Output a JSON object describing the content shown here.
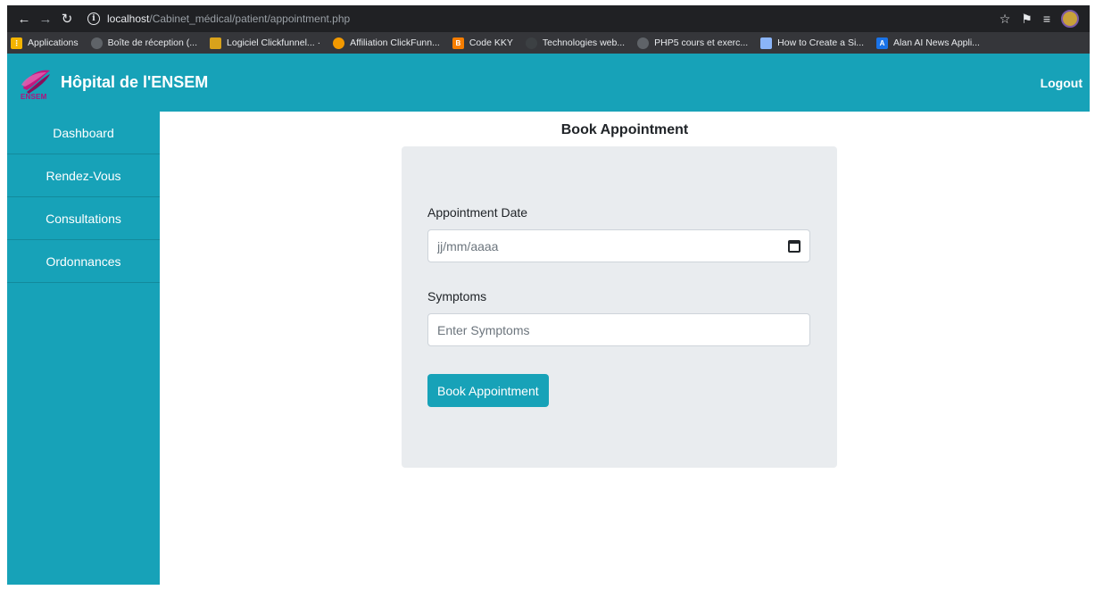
{
  "browser": {
    "url_host": "localhost",
    "url_path": "/Cabinet_médical/patient/appointment.php",
    "bookmarks": [
      {
        "label": "Applications",
        "icon": "apps-grid-icon",
        "color": "#f4b400"
      },
      {
        "label": "Boîte de réception (...",
        "icon": "globe-icon",
        "color": "#5f6368"
      },
      {
        "label": "Logiciel Clickfunnel... ·",
        "icon": "clickfunnels-icon",
        "color": "#d9a21b"
      },
      {
        "label": "Affiliation ClickFunn...",
        "icon": "shield-icon",
        "color": "#f29900"
      },
      {
        "label": "Code KKY",
        "icon": "blogger-icon",
        "color": "#f57d00"
      },
      {
        "label": "Technologies web...",
        "icon": "bookmark-pin-icon",
        "color": "#3c4043"
      },
      {
        "label": "PHP5 cours et exerc...",
        "icon": "globe-icon",
        "color": "#5f6368"
      },
      {
        "label": "How to Create a Si...",
        "icon": "hand-icon",
        "color": "#8ab4f8"
      },
      {
        "label": "Alan AI News Appli...",
        "icon": "alan-ai-icon",
        "color": "#1a73e8"
      }
    ]
  },
  "header": {
    "logo_text": "ENSEM",
    "title": "Hôpital de l'ENSEM",
    "logout": "Logout"
  },
  "sidebar": {
    "items": [
      {
        "label": "Dashboard"
      },
      {
        "label": "Rendez-Vous"
      },
      {
        "label": "Consultations"
      },
      {
        "label": "Ordonnances"
      }
    ]
  },
  "main": {
    "title": "Book Appointment",
    "date_label": "Appointment Date",
    "date_placeholder": "jj/mm/aaaa",
    "symptoms_label": "Symptoms",
    "symptoms_placeholder": "Enter Symptoms",
    "submit_label": "Book Appointment"
  },
  "colors": {
    "accent": "#17a2b8",
    "card_bg": "#e9ecef"
  }
}
